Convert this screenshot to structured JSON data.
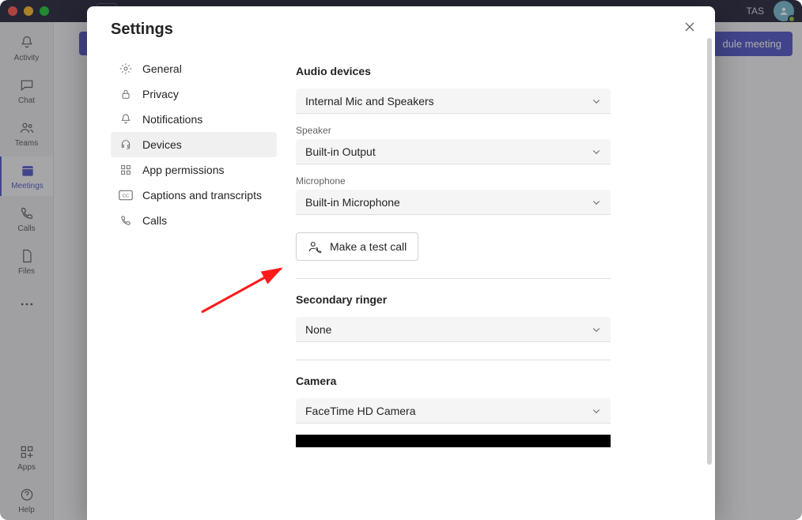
{
  "titlebar": {
    "user_initials": "TAS"
  },
  "rail": {
    "activity": "Activity",
    "chat": "Chat",
    "teams": "Teams",
    "meetings": "Meetings",
    "calls": "Calls",
    "files": "Files",
    "apps": "Apps",
    "help": "Help"
  },
  "topbar": {
    "schedule": "dule meeting"
  },
  "modal": {
    "title": "Settings",
    "nav": {
      "general": "General",
      "privacy": "Privacy",
      "notifications": "Notifications",
      "devices": "Devices",
      "app_permissions": "App permissions",
      "captions": "Captions and transcripts",
      "calls": "Calls"
    },
    "sections": {
      "audio_devices": {
        "title": "Audio devices",
        "device": "Internal Mic and Speakers",
        "speaker_label": "Speaker",
        "speaker": "Built-in Output",
        "mic_label": "Microphone",
        "mic": "Built-in Microphone",
        "test_call": "Make a test call"
      },
      "secondary_ringer": {
        "title": "Secondary ringer",
        "value": "None"
      },
      "camera": {
        "title": "Camera",
        "value": "FaceTime HD Camera"
      }
    }
  }
}
